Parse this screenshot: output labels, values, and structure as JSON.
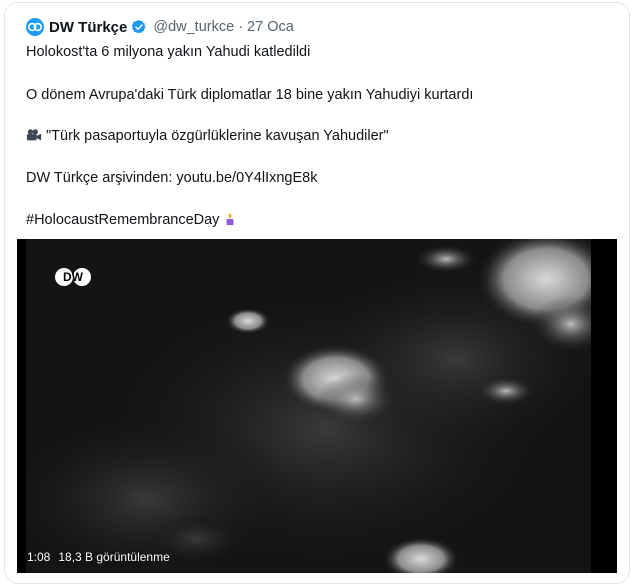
{
  "tweet": {
    "author_name": "DW Türkçe",
    "handle_date": "@dw_turkce · 27 Oca",
    "lines": [
      "Holokost'ta 6 milyona yakın Yahudi katledildi",
      "O dönem Avrupa'daki Türk diplomatlar 18 bine yakın Yahudiyi kurtardı",
      "\"Türk pasaportuyla özgürlüklerine kavuşan Yahudiler\"",
      "DW Türkçe arşivinden: youtu.be/0Y4lIxngE8k",
      "#HolocaustRemembranceDay"
    ],
    "line3_icon": "movie-camera-icon",
    "line5_icon": "candle-icon"
  },
  "video": {
    "duration": "1:08",
    "views": "18,3 B görüntülenme",
    "logo": "DW"
  },
  "colors": {
    "accent": "#1d9bf0",
    "secondary_text": "#536471",
    "border": "#e1e8ed"
  }
}
